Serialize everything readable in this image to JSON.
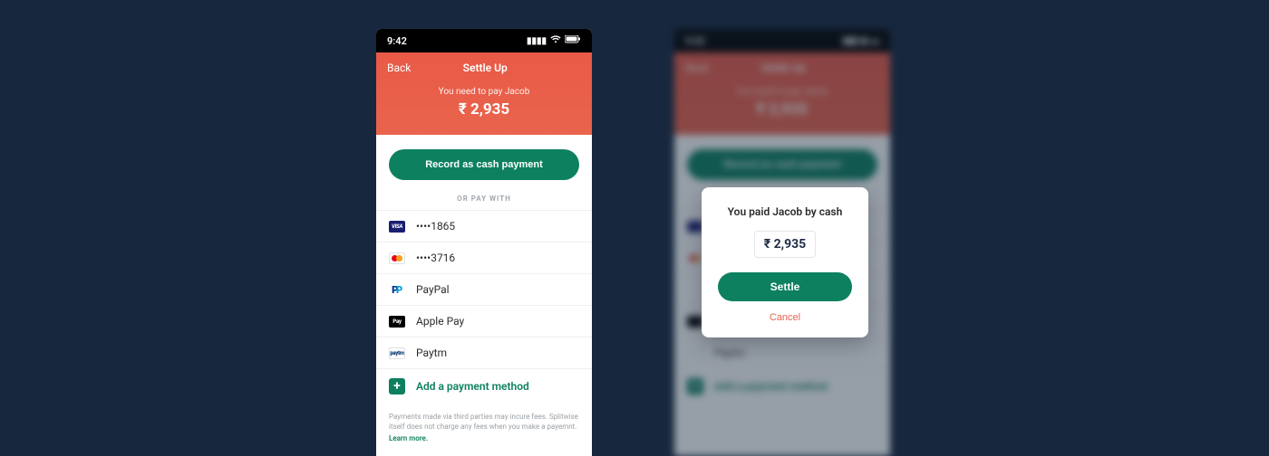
{
  "status": {
    "time": "9:42"
  },
  "nav": {
    "back": "Back",
    "title": "Settle Up"
  },
  "summary": {
    "label": "You need to pay Jacob",
    "amount": "₹ 2,935"
  },
  "primaryButton": "Record as cash payment",
  "orDivider": "OR PAY WITH",
  "methods": [
    {
      "name": "visa",
      "label": "••••1865",
      "badge": "VISA"
    },
    {
      "name": "mastercard",
      "label": "••••3716",
      "badge": ""
    },
    {
      "name": "paypal",
      "label": "PayPal",
      "badge": "P"
    },
    {
      "name": "applepay",
      "label": "Apple Pay",
      "badge": "Pay"
    },
    {
      "name": "paytm",
      "label": "Paytm",
      "badge": "paytm"
    }
  ],
  "addMethod": "Add a payment method",
  "footer": {
    "text": "Payments made via third parties may incure fees. Splitwise itself does not charge any fees when you make a payemnt.",
    "link": "Learn more."
  },
  "modal": {
    "title": "You paid Jacob by cash",
    "amount": "₹ 2,935",
    "settle": "Settle",
    "cancel": "Cancel"
  },
  "colors": {
    "accent": "#0d805f",
    "headerTop": "#e95a47",
    "headerBottom": "#e9644c",
    "background": "#17283e"
  }
}
